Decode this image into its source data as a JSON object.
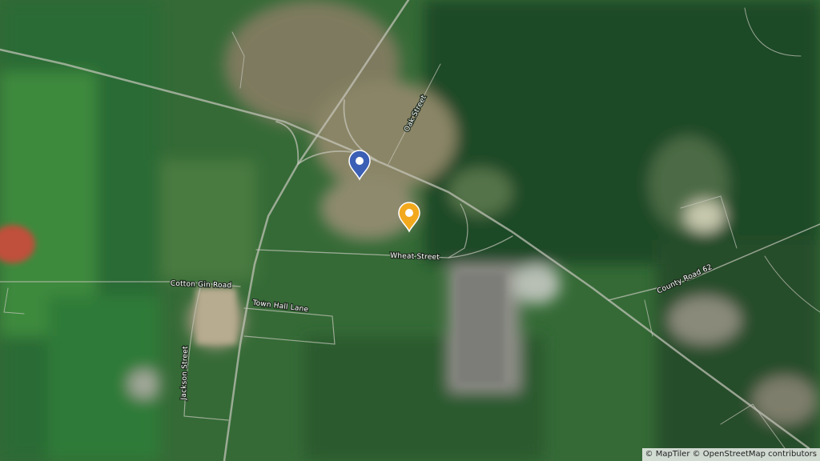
{
  "map": {
    "type": "satellite",
    "street_labels": {
      "oak": "Oak Street",
      "wheat": "Wheat Street",
      "cotton_gin": "Cotton Gin Road",
      "town_hall": "Town Hall Lane",
      "jackson": "Jackson Street",
      "county_road": "County Road 62"
    },
    "markers": [
      {
        "color": "#3b5fb5",
        "icon": "location-pin-icon"
      },
      {
        "color": "#f2a91d",
        "icon": "location-pin-icon"
      }
    ],
    "attribution": {
      "maptiler": "© MapTiler",
      "osm": "© OpenStreetMap contributors"
    }
  }
}
